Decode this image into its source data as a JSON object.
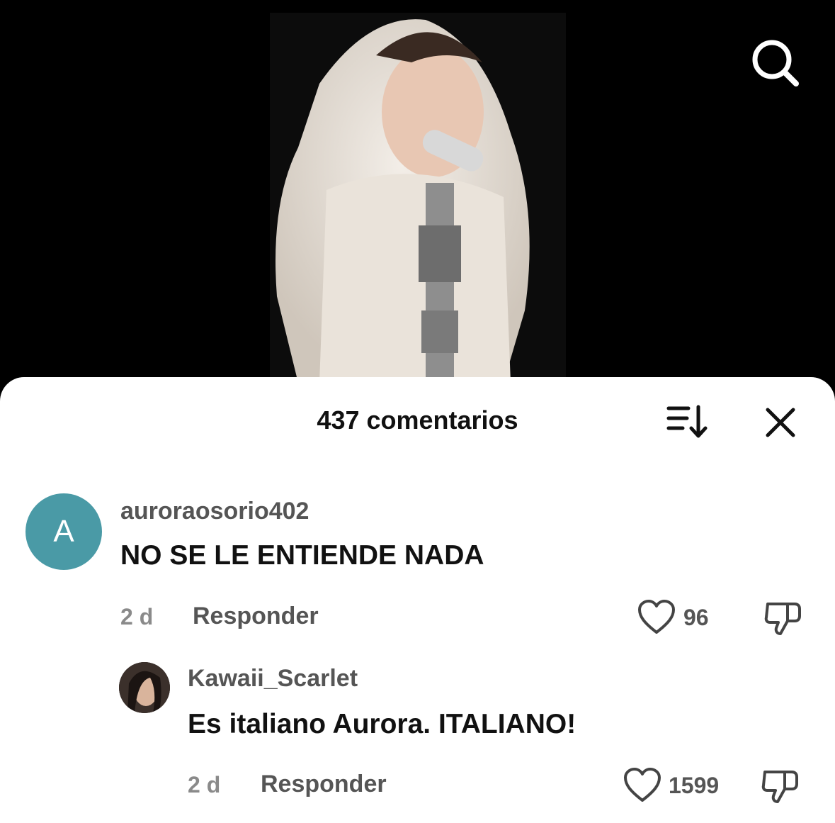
{
  "header": {
    "comment_count_label": "437 comentarios"
  },
  "icons": {
    "search": "search-icon",
    "sort": "sort-icon",
    "close": "close-icon",
    "like": "heart-icon",
    "dislike": "thumbs-down-icon"
  },
  "colors": {
    "avatar_bg": "#4a9aa6",
    "sheet_bg": "#ffffff",
    "video_bg": "#000000"
  },
  "comments": [
    {
      "avatar_letter": "A",
      "username": "auroraosorio402",
      "text": "NO SE LE ENTIENDE NADA",
      "time": "2 d",
      "reply_label": "Responder",
      "likes": "96"
    },
    {
      "username": "Kawaii_Scarlet",
      "text": "Es italiano Aurora. ITALIANO!",
      "time": "2 d",
      "reply_label": "Responder",
      "likes": "1599"
    }
  ]
}
